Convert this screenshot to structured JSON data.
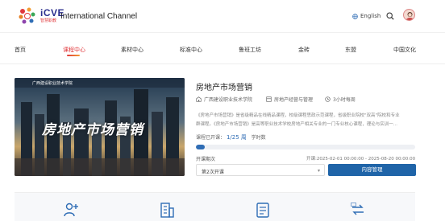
{
  "header": {
    "brand": "iCVE",
    "brand_sub": "智慧职教",
    "channel": "International Channel",
    "language": "English"
  },
  "nav": {
    "items": [
      {
        "label": "首页"
      },
      {
        "label": "课程中心"
      },
      {
        "label": "素材中心"
      },
      {
        "label": "标准中心"
      },
      {
        "label": "鲁班工坊"
      },
      {
        "label": "金砖"
      },
      {
        "label": "东盟"
      },
      {
        "label": "中国文化"
      }
    ],
    "active_index": 1
  },
  "course": {
    "cover_title": "房地产市场营销",
    "cover_school": "广西建设职业技术学院",
    "title": "房地产市场营销",
    "school": "广西建设职业技术学院",
    "category": "房地产经营与管理",
    "hours": "3小时每周",
    "description_lines": [
      "《房地产市场营销》是省级精品在线精品课程，校级课程思政示范课程，省级职业院校\"双高\"院校和专业",
      "群课程。《房地产市场营销》是高等职业技术学校房地产相关专业的一门专业核心课程，理论与实训一..."
    ],
    "progress_label": "课程已开课：",
    "progress_current": "1/25 周",
    "progress_suffix": "学时数",
    "progress_fraction": 0.04,
    "semester_label": "开课期次",
    "date_range": "开课:2025-02-01 00:00:00 - 2025-08-20 00:00:00",
    "semester_value": "第2次开课",
    "button_label": "内容管理"
  },
  "icons": [
    "user-add-icon",
    "building-icon",
    "document-list-icon",
    "exchange-icon"
  ],
  "colors": {
    "accent": "#e0373b",
    "primary": "#1f64a8",
    "brand": "#2b2f8e"
  }
}
